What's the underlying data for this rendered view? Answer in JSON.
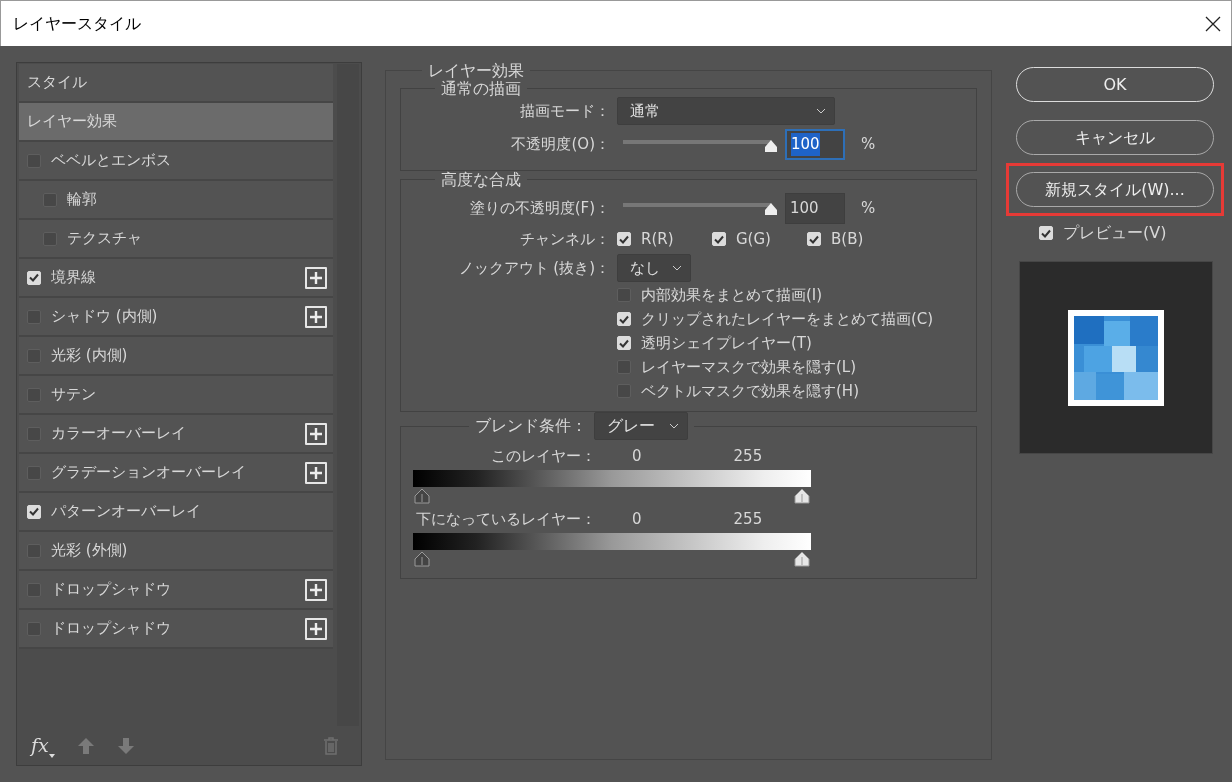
{
  "window": {
    "title": "レイヤースタイル"
  },
  "style_list": {
    "items": [
      {
        "kind": "header",
        "label": "スタイル",
        "selected": false
      },
      {
        "kind": "header",
        "label": "レイヤー効果",
        "selected": true
      },
      {
        "kind": "effect",
        "label": "ベベルとエンボス",
        "checked": false,
        "selected": false,
        "add_button": false,
        "children": [
          {
            "kind": "effect",
            "label": "輪郭",
            "checked": false,
            "selected": false,
            "add_button": false
          },
          {
            "kind": "effect",
            "label": "テクスチャ",
            "checked": false,
            "selected": false,
            "add_button": false
          }
        ]
      },
      {
        "kind": "effect",
        "label": "境界線",
        "checked": true,
        "selected": false,
        "add_button": true
      },
      {
        "kind": "effect",
        "label": "シャドウ (内側)",
        "checked": false,
        "selected": false,
        "add_button": true
      },
      {
        "kind": "effect",
        "label": "光彩 (内側)",
        "checked": false,
        "selected": false,
        "add_button": false
      },
      {
        "kind": "effect",
        "label": "サテン",
        "checked": false,
        "selected": false,
        "add_button": false
      },
      {
        "kind": "effect",
        "label": "カラーオーバーレイ",
        "checked": false,
        "selected": false,
        "add_button": true
      },
      {
        "kind": "effect",
        "label": "グラデーションオーバーレイ",
        "checked": false,
        "selected": false,
        "add_button": true
      },
      {
        "kind": "effect",
        "label": "パターンオーバーレイ",
        "checked": true,
        "selected": false,
        "add_button": false
      },
      {
        "kind": "effect",
        "label": "光彩 (外側)",
        "checked": false,
        "selected": false,
        "add_button": false
      },
      {
        "kind": "effect",
        "label": "ドロップシャドウ",
        "checked": false,
        "selected": false,
        "add_button": true
      },
      {
        "kind": "effect",
        "label": "ドロップシャドウ",
        "checked": false,
        "selected": false,
        "add_button": true
      }
    ],
    "footer": {
      "fx_label": "fx"
    }
  },
  "layer_effects": {
    "title": "レイヤー効果",
    "normal_drawing": {
      "title": "通常の描画",
      "blend_mode": {
        "label": "描画モード：",
        "value": "通常"
      },
      "opacity": {
        "label": "不透明度(O)：",
        "level": 1,
        "value": "100",
        "unit": "%",
        "focused": true
      }
    },
    "advanced_blending": {
      "title": "高度な合成",
      "fill_opacity": {
        "label": "塗りの不透明度(F)：",
        "level": 1,
        "value": "100",
        "unit": "%",
        "focused": false
      },
      "channels": {
        "label": "チャンネル：",
        "items": [
          {
            "label": "R(R)",
            "checked": true
          },
          {
            "label": "G(G)",
            "checked": true
          },
          {
            "label": "B(B)",
            "checked": true
          }
        ]
      },
      "knockout": {
        "label": "ノックアウト (抜き)：",
        "value": "なし"
      },
      "options": [
        {
          "label": "内部効果をまとめて描画(I)",
          "checked": false
        },
        {
          "label": "クリップされたレイヤーをまとめて描画(C)",
          "checked": true
        },
        {
          "label": "透明シェイプレイヤー(T)",
          "checked": true
        },
        {
          "label": "レイヤーマスクで効果を隠す(L)",
          "checked": false
        },
        {
          "label": "ベクトルマスクで効果を隠す(H)",
          "checked": false
        }
      ]
    },
    "blend_if": {
      "label": "ブレンド条件：",
      "value": "グレー",
      "bars": [
        {
          "label": "このレイヤー：",
          "readings": [
            "0",
            "255"
          ],
          "thumbs": [
            {
              "level": 0
            },
            {
              "level": 1
            }
          ]
        },
        {
          "label": "下になっているレイヤー：",
          "readings": [
            "0",
            "255"
          ],
          "thumbs": [
            {
              "level": 0
            },
            {
              "level": 1
            }
          ]
        }
      ]
    }
  },
  "buttons": [
    {
      "label": "OK",
      "highlighted": false
    },
    {
      "label": "キャンセル",
      "highlighted": false
    },
    {
      "label": "新規スタイル(W)...",
      "highlighted": true
    }
  ],
  "preview": {
    "label": "プレビュー(V)",
    "checked": true
  }
}
